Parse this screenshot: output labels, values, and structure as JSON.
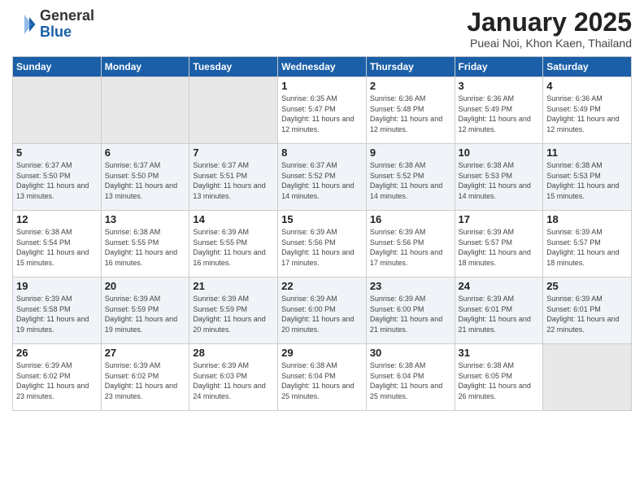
{
  "header": {
    "logo_general": "General",
    "logo_blue": "Blue",
    "title": "January 2025",
    "subtitle": "Pueai Noi, Khon Kaen, Thailand"
  },
  "days_of_week": [
    "Sunday",
    "Monday",
    "Tuesday",
    "Wednesday",
    "Thursday",
    "Friday",
    "Saturday"
  ],
  "weeks": [
    [
      {
        "day": "",
        "empty": true
      },
      {
        "day": "",
        "empty": true
      },
      {
        "day": "",
        "empty": true
      },
      {
        "day": "1",
        "sunrise": "Sunrise: 6:35 AM",
        "sunset": "Sunset: 5:47 PM",
        "daylight": "Daylight: 11 hours and 12 minutes."
      },
      {
        "day": "2",
        "sunrise": "Sunrise: 6:36 AM",
        "sunset": "Sunset: 5:48 PM",
        "daylight": "Daylight: 11 hours and 12 minutes."
      },
      {
        "day": "3",
        "sunrise": "Sunrise: 6:36 AM",
        "sunset": "Sunset: 5:49 PM",
        "daylight": "Daylight: 11 hours and 12 minutes."
      },
      {
        "day": "4",
        "sunrise": "Sunrise: 6:36 AM",
        "sunset": "Sunset: 5:49 PM",
        "daylight": "Daylight: 11 hours and 12 minutes."
      }
    ],
    [
      {
        "day": "5",
        "sunrise": "Sunrise: 6:37 AM",
        "sunset": "Sunset: 5:50 PM",
        "daylight": "Daylight: 11 hours and 13 minutes."
      },
      {
        "day": "6",
        "sunrise": "Sunrise: 6:37 AM",
        "sunset": "Sunset: 5:50 PM",
        "daylight": "Daylight: 11 hours and 13 minutes."
      },
      {
        "day": "7",
        "sunrise": "Sunrise: 6:37 AM",
        "sunset": "Sunset: 5:51 PM",
        "daylight": "Daylight: 11 hours and 13 minutes."
      },
      {
        "day": "8",
        "sunrise": "Sunrise: 6:37 AM",
        "sunset": "Sunset: 5:52 PM",
        "daylight": "Daylight: 11 hours and 14 minutes."
      },
      {
        "day": "9",
        "sunrise": "Sunrise: 6:38 AM",
        "sunset": "Sunset: 5:52 PM",
        "daylight": "Daylight: 11 hours and 14 minutes."
      },
      {
        "day": "10",
        "sunrise": "Sunrise: 6:38 AM",
        "sunset": "Sunset: 5:53 PM",
        "daylight": "Daylight: 11 hours and 14 minutes."
      },
      {
        "day": "11",
        "sunrise": "Sunrise: 6:38 AM",
        "sunset": "Sunset: 5:53 PM",
        "daylight": "Daylight: 11 hours and 15 minutes."
      }
    ],
    [
      {
        "day": "12",
        "sunrise": "Sunrise: 6:38 AM",
        "sunset": "Sunset: 5:54 PM",
        "daylight": "Daylight: 11 hours and 15 minutes."
      },
      {
        "day": "13",
        "sunrise": "Sunrise: 6:38 AM",
        "sunset": "Sunset: 5:55 PM",
        "daylight": "Daylight: 11 hours and 16 minutes."
      },
      {
        "day": "14",
        "sunrise": "Sunrise: 6:39 AM",
        "sunset": "Sunset: 5:55 PM",
        "daylight": "Daylight: 11 hours and 16 minutes."
      },
      {
        "day": "15",
        "sunrise": "Sunrise: 6:39 AM",
        "sunset": "Sunset: 5:56 PM",
        "daylight": "Daylight: 11 hours and 17 minutes."
      },
      {
        "day": "16",
        "sunrise": "Sunrise: 6:39 AM",
        "sunset": "Sunset: 5:56 PM",
        "daylight": "Daylight: 11 hours and 17 minutes."
      },
      {
        "day": "17",
        "sunrise": "Sunrise: 6:39 AM",
        "sunset": "Sunset: 5:57 PM",
        "daylight": "Daylight: 11 hours and 18 minutes."
      },
      {
        "day": "18",
        "sunrise": "Sunrise: 6:39 AM",
        "sunset": "Sunset: 5:57 PM",
        "daylight": "Daylight: 11 hours and 18 minutes."
      }
    ],
    [
      {
        "day": "19",
        "sunrise": "Sunrise: 6:39 AM",
        "sunset": "Sunset: 5:58 PM",
        "daylight": "Daylight: 11 hours and 19 minutes."
      },
      {
        "day": "20",
        "sunrise": "Sunrise: 6:39 AM",
        "sunset": "Sunset: 5:59 PM",
        "daylight": "Daylight: 11 hours and 19 minutes."
      },
      {
        "day": "21",
        "sunrise": "Sunrise: 6:39 AM",
        "sunset": "Sunset: 5:59 PM",
        "daylight": "Daylight: 11 hours and 20 minutes."
      },
      {
        "day": "22",
        "sunrise": "Sunrise: 6:39 AM",
        "sunset": "Sunset: 6:00 PM",
        "daylight": "Daylight: 11 hours and 20 minutes."
      },
      {
        "day": "23",
        "sunrise": "Sunrise: 6:39 AM",
        "sunset": "Sunset: 6:00 PM",
        "daylight": "Daylight: 11 hours and 21 minutes."
      },
      {
        "day": "24",
        "sunrise": "Sunrise: 6:39 AM",
        "sunset": "Sunset: 6:01 PM",
        "daylight": "Daylight: 11 hours and 21 minutes."
      },
      {
        "day": "25",
        "sunrise": "Sunrise: 6:39 AM",
        "sunset": "Sunset: 6:01 PM",
        "daylight": "Daylight: 11 hours and 22 minutes."
      }
    ],
    [
      {
        "day": "26",
        "sunrise": "Sunrise: 6:39 AM",
        "sunset": "Sunset: 6:02 PM",
        "daylight": "Daylight: 11 hours and 23 minutes."
      },
      {
        "day": "27",
        "sunrise": "Sunrise: 6:39 AM",
        "sunset": "Sunset: 6:02 PM",
        "daylight": "Daylight: 11 hours and 23 minutes."
      },
      {
        "day": "28",
        "sunrise": "Sunrise: 6:39 AM",
        "sunset": "Sunset: 6:03 PM",
        "daylight": "Daylight: 11 hours and 24 minutes."
      },
      {
        "day": "29",
        "sunrise": "Sunrise: 6:38 AM",
        "sunset": "Sunset: 6:04 PM",
        "daylight": "Daylight: 11 hours and 25 minutes."
      },
      {
        "day": "30",
        "sunrise": "Sunrise: 6:38 AM",
        "sunset": "Sunset: 6:04 PM",
        "daylight": "Daylight: 11 hours and 25 minutes."
      },
      {
        "day": "31",
        "sunrise": "Sunrise: 6:38 AM",
        "sunset": "Sunset: 6:05 PM",
        "daylight": "Daylight: 11 hours and 26 minutes."
      },
      {
        "day": "",
        "empty": true
      }
    ]
  ]
}
